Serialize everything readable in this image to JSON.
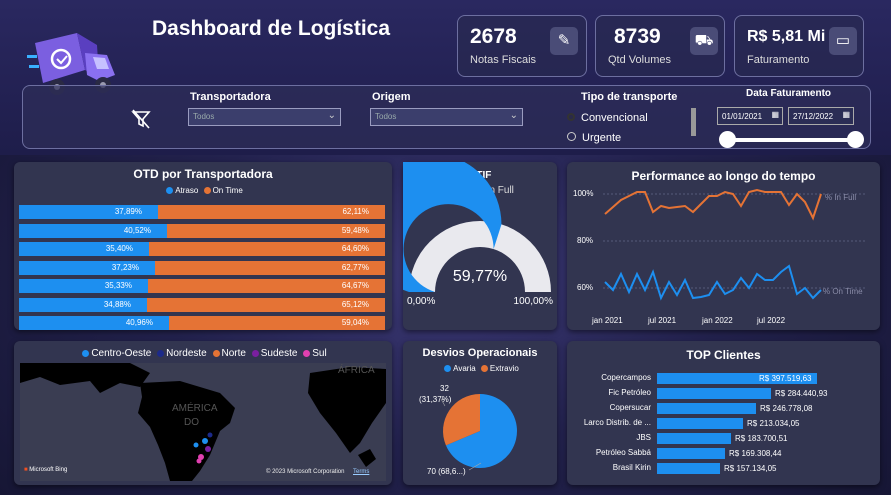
{
  "header": {
    "title": "Dashboard de Logística"
  },
  "kpis": [
    {
      "value": "2678",
      "label": "Notas Fiscais",
      "icon": "invoice-icon"
    },
    {
      "value": "8739",
      "label": "Qtd Volumes",
      "icon": "hand-truck-icon"
    },
    {
      "value": "R$ 5,81 Mi",
      "label": "Faturamento",
      "icon": "cash-icon"
    }
  ],
  "filters": {
    "transportadora": {
      "label": "Transportadora",
      "value": "Todos"
    },
    "origem": {
      "label": "Origem",
      "value": "Todos"
    },
    "tipo": {
      "label": "Tipo de transporte",
      "options": [
        "Convencional",
        "Urgente"
      ],
      "selected": "Convencional"
    },
    "data": {
      "label": "Data Faturamento",
      "start": "01/01/2021",
      "end": "27/12/2022"
    }
  },
  "otd": {
    "title": "OTD  por Transportadora",
    "legend": [
      "Atraso",
      "On Time"
    ],
    "colors": {
      "atraso": "#1d8ff0",
      "ontime": "#e57335"
    },
    "rows": [
      {
        "atraso": 37.89,
        "atraso_label": "37,89%",
        "ontime_label": "62,11%"
      },
      {
        "atraso": 40.52,
        "atraso_label": "40,52%",
        "ontime_label": "59,48%"
      },
      {
        "atraso": 35.4,
        "atraso_label": "35,40%",
        "ontime_label": "64,60%"
      },
      {
        "atraso": 37.23,
        "atraso_label": "37,23%",
        "ontime_label": "62,77%"
      },
      {
        "atraso": 35.33,
        "atraso_label": "35,33%",
        "ontime_label": "64,67%"
      },
      {
        "atraso": 34.88,
        "atraso_label": "34,88%",
        "ontime_label": "65,12%"
      },
      {
        "atraso": 40.96,
        "atraso_label": "40,96%",
        "ontime_label": "59,04%"
      }
    ]
  },
  "otif": {
    "title": "OTIF",
    "subtitle": "On Time In Full",
    "value": 59.77,
    "value_label": "59,77%",
    "min_label": "0,00%",
    "max_label": "100,00%"
  },
  "performance": {
    "title": "Performance ao longo do tempo",
    "series_labels": [
      "% In Full",
      "% On Time"
    ],
    "y_ticks": [
      "100%",
      "80%",
      "60%"
    ],
    "x_ticks": [
      "jan 2021",
      "jul 2021",
      "jan 2022",
      "jul 2022"
    ]
  },
  "map": {
    "legend": [
      "Centro-Oeste",
      "Nordeste",
      "Norte",
      "Sudeste",
      "Sul"
    ],
    "legend_colors": [
      "#1d8ff0",
      "#1c2a8a",
      "#e57335",
      "#7a1fa0",
      "#e040b0"
    ],
    "label_america": "AMÉRICA",
    "label_do": "DO",
    "label_africa": "ÁFRICA",
    "provider": "Microsoft Bing",
    "copyright": "© 2023 Microsoft Corporation",
    "terms": "Terms"
  },
  "desvios": {
    "title": "Desvios Operacionais",
    "legend": [
      "Avaria",
      "Extravio"
    ],
    "slices": [
      {
        "name": "Avaria",
        "value": 70,
        "label": "70 (68,6...)",
        "color": "#1d8ff0"
      },
      {
        "name": "Extravio",
        "value": 32,
        "label": "32",
        "label2": "(31,37%)",
        "color": "#e57335"
      }
    ]
  },
  "top_clientes": {
    "title": "TOP Clientes",
    "rows": [
      {
        "name": "Copercampos",
        "value": 397519.63,
        "label": "R$ 397.519,63"
      },
      {
        "name": "Fic Petróleo",
        "value": 284440.93,
        "label": "R$ 284.440,93"
      },
      {
        "name": "Copersucar",
        "value": 246778.08,
        "label": "R$ 246.778,08"
      },
      {
        "name": "Larco Distrib. de ...",
        "value": 213034.05,
        "label": "R$ 213.034,05"
      },
      {
        "name": "JBS",
        "value": 183700.51,
        "label": "R$ 183.700,51"
      },
      {
        "name": "Petróleo Sabbá",
        "value": 169308.44,
        "label": "R$ 169.308,44"
      },
      {
        "name": "Brasil Kirin",
        "value": 157134.05,
        "label": "R$ 157.134,05"
      }
    ]
  }
}
